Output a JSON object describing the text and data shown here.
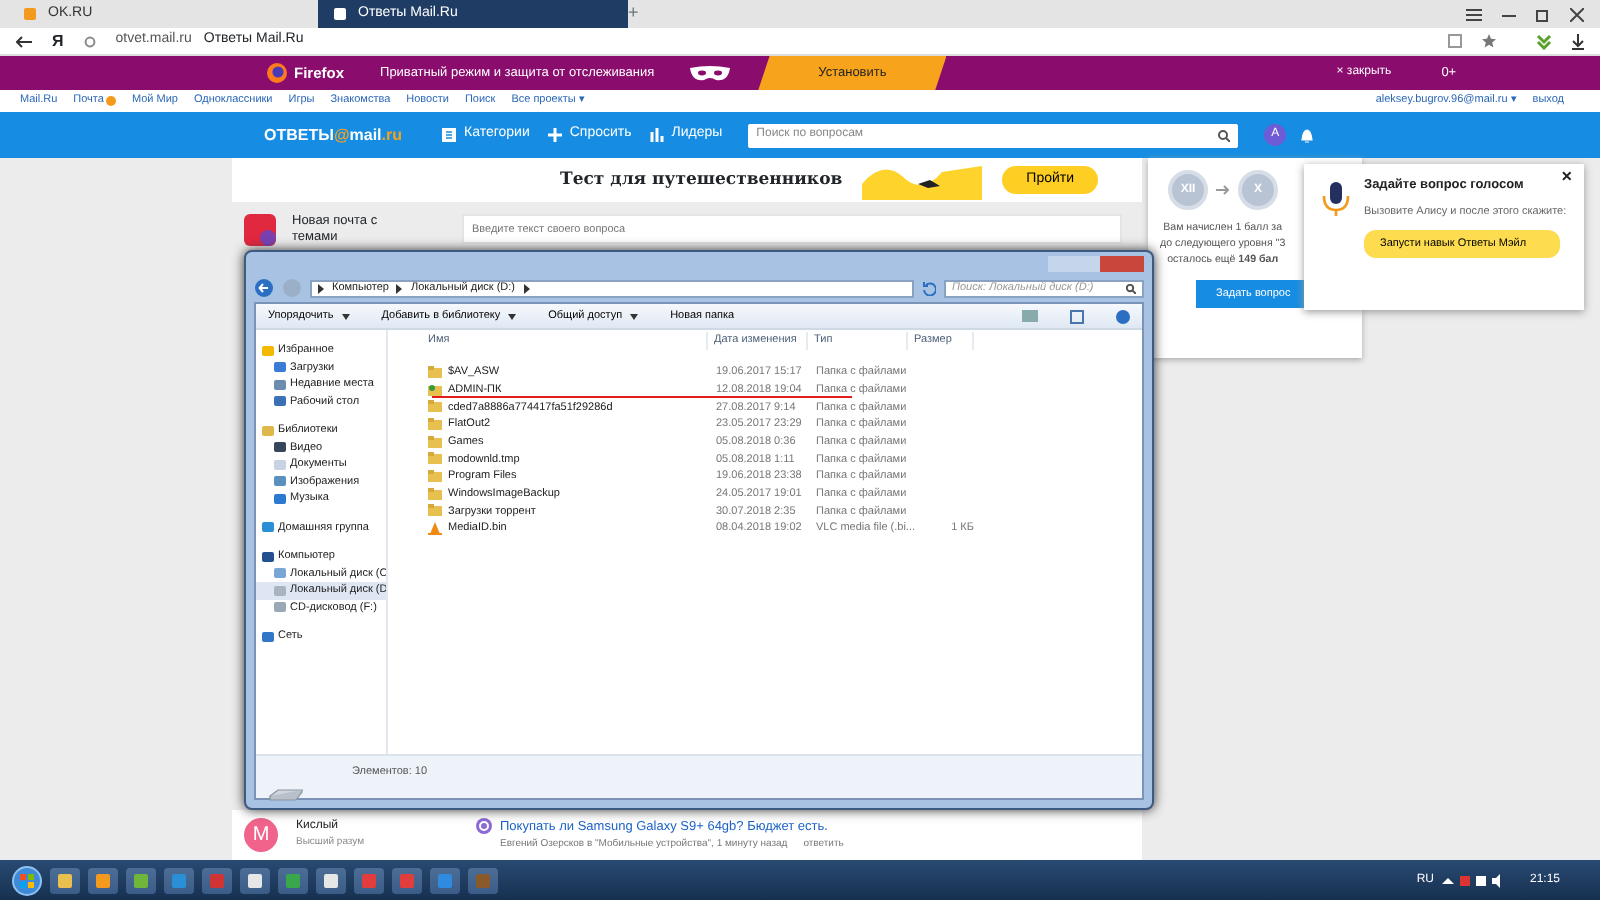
{
  "browser": {
    "tabs": [
      {
        "label": "OK.RU",
        "selected": false
      },
      {
        "label": "Ответы Mail.Ru",
        "selected": true
      }
    ],
    "new_tab": "+",
    "yandex_button": "Я",
    "url": "otvet.mail.ru",
    "page_title": "Ответы Mail.Ru"
  },
  "promo_bar": {
    "brand": "Firefox",
    "text": "Приватный режим и защита от отслеживания",
    "install_button": "Установить",
    "close": "× закрыть",
    "counter": "0+"
  },
  "portal_nav": {
    "links": [
      "Mail.Ru",
      "Почта",
      "Мой Мир",
      "Одноклассники",
      "Игры",
      "Знакомства",
      "Новости",
      "Поиск",
      "Все проекты ▾"
    ],
    "account": "aleksey.bugrov.96@mail.ru ▾",
    "logout": "выход"
  },
  "header": {
    "logo": {
      "prefix": "ОТВЕТЫ",
      "at": "@",
      "domain": "mail",
      "tld": ".ru"
    },
    "nav": [
      {
        "label": "Категории",
        "kind": "grid"
      },
      {
        "label": "Спросить",
        "kind": "plus"
      },
      {
        "label": "Лидеры",
        "kind": "bars"
      }
    ],
    "search_placeholder": "Поиск по вопросам",
    "avatar": "А"
  },
  "banner": {
    "title": "Тест для путешественников",
    "button": "Пройти"
  },
  "sidebar_card": {
    "text": "Новая почта с темами"
  },
  "question_input": {
    "placeholder": "Введите текст своего вопроса"
  },
  "level_panel": {
    "from": "XII",
    "to": "X",
    "lines": [
      "Вам начислен 1 балл за",
      "до следующего уровня \"3",
      "осталось ещё **149 бал**"
    ],
    "button": "Задать вопрос"
  },
  "voice_popup": {
    "title": "Задайте вопрос голосом",
    "text": "Вызовите Алису и после этого скажите:",
    "command": "Запусти навык Ответы Мэйл",
    "close": "×"
  },
  "feed": {
    "user": {
      "initial": "M",
      "name": "Кислый",
      "rank": "Высший разум"
    },
    "question": {
      "title": "Покупать ли Samsung Galaxy S9+ 64gb? Бюджет есть.",
      "meta": "Евгений Озерсков в \"Мобильные устройства\", 1 минуту назад",
      "reply": "ответить"
    }
  },
  "explorer": {
    "path": [
      "Компьютер",
      "Локальный диск (D:)"
    ],
    "search_placeholder": "Поиск: Локальный диск (D:)",
    "toolbar": [
      {
        "label": "Упорядочить",
        "dropdown": true
      },
      {
        "label": "Добавить в библиотеку",
        "dropdown": true
      },
      {
        "label": "Общий доступ",
        "dropdown": true
      },
      {
        "label": "Новая папка",
        "dropdown": false
      }
    ],
    "nav": [
      {
        "label": "Избранное",
        "kind": "star",
        "selected": false,
        "children": [
          {
            "label": "Загрузки",
            "kind": "download",
            "selected": false
          },
          {
            "label": "Недавние места",
            "kind": "recent",
            "selected": false
          },
          {
            "label": "Рабочий стол",
            "kind": "desktop",
            "selected": false
          }
        ]
      },
      {
        "label": "Библиотеки",
        "kind": "library",
        "selected": false,
        "children": [
          {
            "label": "Видео",
            "kind": "video",
            "selected": false
          },
          {
            "label": "Документы",
            "kind": "document",
            "selected": false
          },
          {
            "label": "Изображения",
            "kind": "image",
            "selected": false
          },
          {
            "label": "Музыка",
            "kind": "music",
            "selected": false
          }
        ]
      },
      {
        "label": "Домашняя группа",
        "kind": "homegroup",
        "selected": false
      },
      {
        "label": "Компьютер",
        "kind": "computer",
        "selected": false,
        "children": [
          {
            "label": "Локальный диск (C",
            "kind": "system-disk",
            "selected": false
          },
          {
            "label": "Локальный диск (D",
            "kind": "disk",
            "selected": true
          },
          {
            "label": "CD-дисковод (F:)",
            "kind": "cd",
            "selected": false
          }
        ]
      },
      {
        "label": "Сеть",
        "kind": "network",
        "selected": false
      }
    ],
    "columns": [
      "Имя",
      "Дата изменения",
      "Тип",
      "Размер"
    ],
    "rows": [
      {
        "name": "$AV_ASW",
        "date": "19.06.2017 15:17",
        "type": "Папка с файлами",
        "size": "",
        "kind": "folder",
        "underlined": false
      },
      {
        "name": "ADMIN-ПК",
        "date": "12.08.2018 19:04",
        "type": "Папка с файлами",
        "size": "",
        "kind": "user-folder",
        "underlined": true
      },
      {
        "name": "cded7a8886a774417fa51f29286d",
        "date": "27.08.2017 9:14",
        "type": "Папка с файлами",
        "size": "",
        "kind": "folder",
        "underlined": false
      },
      {
        "name": "FlatOut2",
        "date": "23.05.2017 23:29",
        "type": "Папка с файлами",
        "size": "",
        "kind": "folder",
        "underlined": false
      },
      {
        "name": "Games",
        "date": "05.08.2018 0:36",
        "type": "Папка с файлами",
        "size": "",
        "kind": "folder",
        "underlined": false
      },
      {
        "name": "modownld.tmp",
        "date": "05.08.2018 1:11",
        "type": "Папка с файлами",
        "size": "",
        "kind": "folder",
        "underlined": false
      },
      {
        "name": "Program Files",
        "date": "19.06.2018 23:38",
        "type": "Папка с файлами",
        "size": "",
        "kind": "folder",
        "underlined": false
      },
      {
        "name": "WindowsImageBackup",
        "date": "24.05.2017 19:01",
        "type": "Папка с файлами",
        "size": "",
        "kind": "folder",
        "underlined": false
      },
      {
        "name": "Загрузки торрент",
        "date": "30.07.2018 2:35",
        "type": "Папка с файлами",
        "size": "",
        "kind": "folder",
        "underlined": false
      },
      {
        "name": "MediaID.bin",
        "date": "08.04.2018 19:02",
        "type": "VLC media file (.bi...",
        "size": "1 КБ",
        "kind": "media",
        "underlined": false
      }
    ],
    "status": "Элементов: 10"
  },
  "taskbar": {
    "language": "RU",
    "time": "21:15"
  }
}
